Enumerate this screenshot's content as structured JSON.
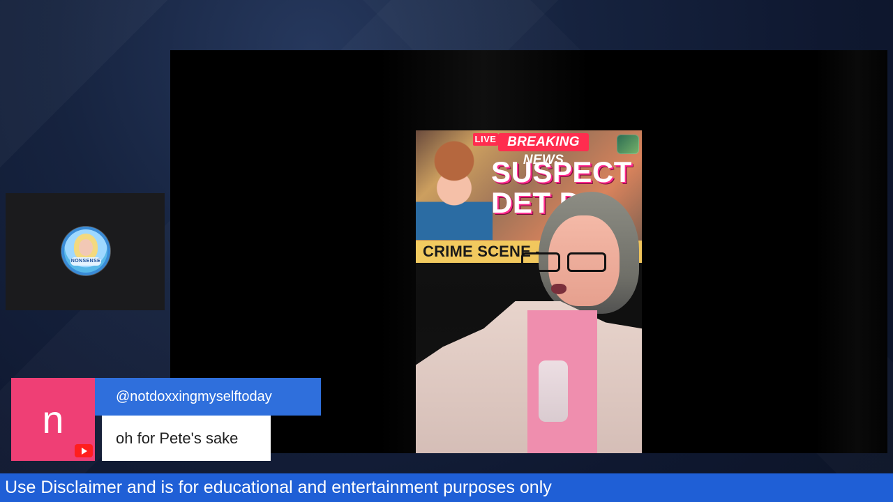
{
  "main_video": {
    "banner": {
      "live": "LIVE",
      "breaking": "BREAKING NEWS",
      "title_line1": "SUSPECT",
      "title_line2": "DET D",
      "crime_scene": "CRIME SCENE -"
    }
  },
  "side_panel": {
    "avatar_text": "NONSENSE"
  },
  "comment": {
    "initial": "n",
    "username": "@notdoxxingmyselftoday",
    "message": "oh for Pete's sake",
    "platform_icon": "youtube-icon"
  },
  "ticker": {
    "text": "Use Disclaimer and is for educational and entertainment purposes only"
  },
  "colors": {
    "ticker_bg": "#1f5fd6",
    "username_bg": "#2f6fdc",
    "avatar_bg": "#ef3f75",
    "breaking_red": "#ff2d4f"
  }
}
